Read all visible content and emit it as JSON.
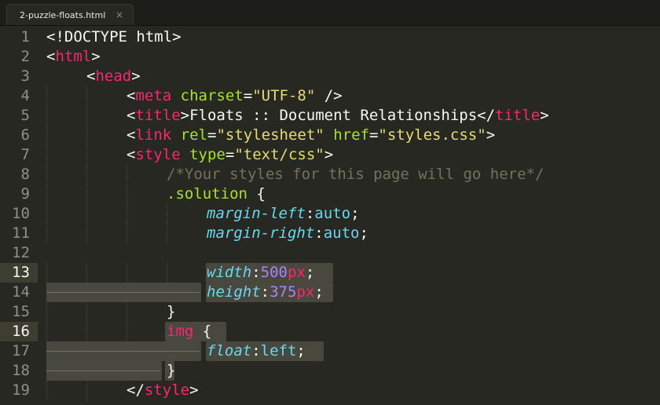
{
  "tab": {
    "title": "2-puzzle-floats.html",
    "close_glyph": "×"
  },
  "colors": {
    "background": "#272822",
    "tag": "#f92672",
    "attribute": "#a6e22e",
    "string": "#e6db74",
    "comment": "#75715e",
    "property": "#66d9ef",
    "number": "#ae81ff"
  },
  "lines": [
    {
      "n": "1",
      "indent": 0,
      "tokens": [
        [
          "p",
          "<!DOCTYPE html>"
        ]
      ]
    },
    {
      "n": "2",
      "indent": 0,
      "tokens": [
        [
          "p",
          "<"
        ],
        [
          "tag",
          "html"
        ],
        [
          "p",
          ">"
        ]
      ]
    },
    {
      "n": "3",
      "indent": 1,
      "tokens": [
        [
          "p",
          "<"
        ],
        [
          "tag",
          "head"
        ],
        [
          "p",
          ">"
        ]
      ]
    },
    {
      "n": "4",
      "indent": 2,
      "tokens": [
        [
          "p",
          "<"
        ],
        [
          "tag",
          "meta"
        ],
        [
          "p",
          " "
        ],
        [
          "attr",
          "charset"
        ],
        [
          "p",
          "="
        ],
        [
          "str",
          "\"UTF-8\""
        ],
        [
          "p",
          " />"
        ]
      ]
    },
    {
      "n": "5",
      "indent": 2,
      "tokens": [
        [
          "p",
          "<"
        ],
        [
          "tag",
          "title"
        ],
        [
          "p",
          ">Floats :: Document Relationships</"
        ],
        [
          "tag",
          "title"
        ],
        [
          "p",
          ">"
        ]
      ]
    },
    {
      "n": "6",
      "indent": 2,
      "tokens": [
        [
          "p",
          "<"
        ],
        [
          "tag",
          "link"
        ],
        [
          "p",
          " "
        ],
        [
          "attr",
          "rel"
        ],
        [
          "p",
          "="
        ],
        [
          "str",
          "\"stylesheet\""
        ],
        [
          "p",
          " "
        ],
        [
          "attr",
          "href"
        ],
        [
          "p",
          "="
        ],
        [
          "str",
          "\"styles.css\""
        ],
        [
          "p",
          ">"
        ]
      ]
    },
    {
      "n": "7",
      "indent": 2,
      "tokens": [
        [
          "p",
          "<"
        ],
        [
          "tag",
          "style"
        ],
        [
          "p",
          " "
        ],
        [
          "attr",
          "type"
        ],
        [
          "p",
          "="
        ],
        [
          "str",
          "\"text/css\""
        ],
        [
          "p",
          ">"
        ]
      ]
    },
    {
      "n": "8",
      "indent": 3,
      "tokens": [
        [
          "com",
          "/*Your styles for this page will go here*/"
        ]
      ]
    },
    {
      "n": "9",
      "indent": 3,
      "tokens": [
        [
          "sel",
          ".solution"
        ],
        [
          "p",
          " {"
        ]
      ]
    },
    {
      "n": "10",
      "indent": 4,
      "tokens": [
        [
          "prop",
          "margin-left"
        ],
        [
          "p",
          ":"
        ],
        [
          "val",
          "auto"
        ],
        [
          "p",
          ";"
        ]
      ]
    },
    {
      "n": "11",
      "indent": 4,
      "tokens": [
        [
          "prop",
          "margin-right"
        ],
        [
          "p",
          ":"
        ],
        [
          "val",
          "auto"
        ],
        [
          "p",
          ";"
        ]
      ]
    },
    {
      "n": "12",
      "indent": 0,
      "tokens": []
    },
    {
      "n": "13",
      "indent": 4,
      "tokens": [
        [
          "prop",
          "width"
        ],
        [
          "p",
          ":"
        ],
        [
          "num",
          "500"
        ],
        [
          "unit",
          "px"
        ],
        [
          "p",
          ";"
        ]
      ]
    },
    {
      "n": "14",
      "indent": 4,
      "tokens": [
        [
          "prop",
          "height"
        ],
        [
          "p",
          ":"
        ],
        [
          "num",
          "375"
        ],
        [
          "unit",
          "px"
        ],
        [
          "p",
          ";"
        ]
      ]
    },
    {
      "n": "15",
      "indent": 3,
      "tokens": [
        [
          "p",
          "}"
        ]
      ]
    },
    {
      "n": "16",
      "indent": 3,
      "tokens": [
        [
          "tag",
          "img"
        ],
        [
          "p",
          " {"
        ]
      ]
    },
    {
      "n": "17",
      "indent": 4,
      "tokens": [
        [
          "prop",
          "float"
        ],
        [
          "p",
          ":"
        ],
        [
          "val",
          "left"
        ],
        [
          "p",
          ";"
        ]
      ]
    },
    {
      "n": "18",
      "indent": 3,
      "tokens": [
        [
          "p",
          "}"
        ]
      ]
    },
    {
      "n": "19",
      "indent": 2,
      "tokens": [
        [
          "p",
          "</"
        ],
        [
          "tag",
          "style"
        ],
        [
          "p",
          ">"
        ]
      ]
    }
  ]
}
